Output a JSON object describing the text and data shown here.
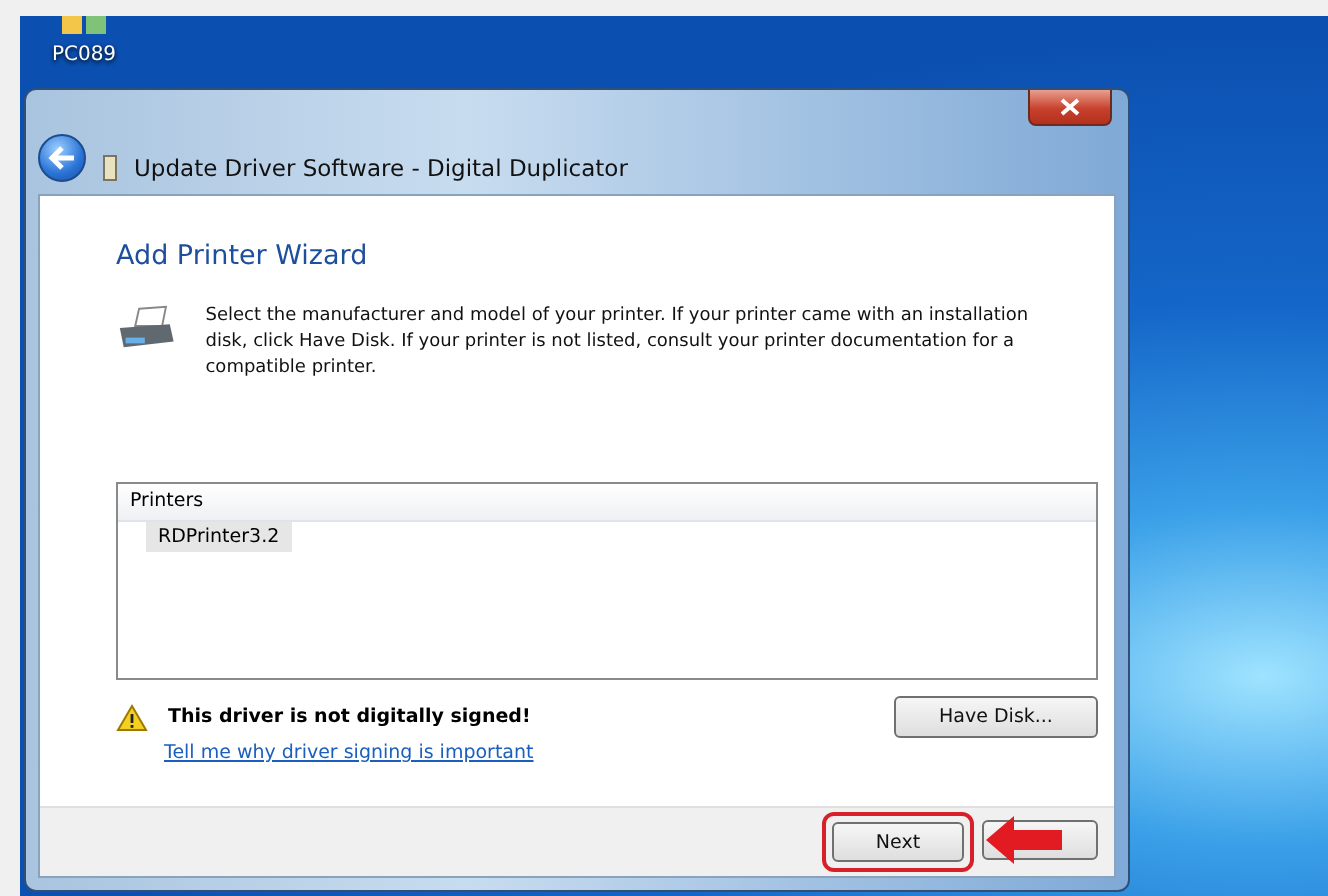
{
  "desktop": {
    "icon_label": "PC089"
  },
  "window": {
    "title": "Update Driver Software -  Digital Duplicator"
  },
  "wizard": {
    "heading": "Add Printer Wizard",
    "description": "Select the manufacturer and model of your printer. If your printer came with an installation disk, click Have Disk. If your printer is not listed, consult your printer documentation for a compatible printer."
  },
  "printer_list": {
    "header": "Printers",
    "items": [
      {
        "label": "RDPrinter3.2",
        "selected": true
      }
    ]
  },
  "warning": {
    "text": "This driver is not digitally signed!",
    "link": "Tell me why driver signing is important"
  },
  "have_disk_button": "Have Disk...",
  "footer": {
    "next_button": "Next",
    "next_highlighted": true
  }
}
